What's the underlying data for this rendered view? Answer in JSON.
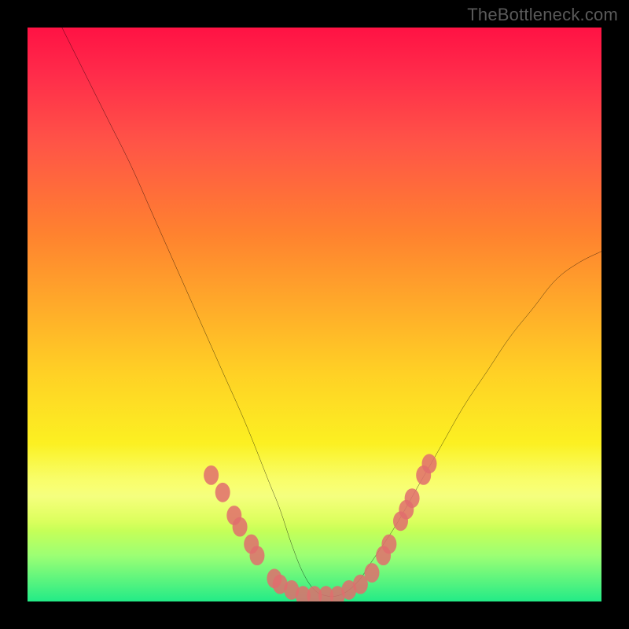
{
  "watermark": "TheBottleneck.com",
  "colors": {
    "frame": "#000000",
    "curve": "#000000",
    "marker": "#e06d6d",
    "gradient_top": "#ff1244",
    "gradient_bottom": "#23eb87"
  },
  "chart_data": {
    "type": "line",
    "title": "",
    "xlabel": "",
    "ylabel": "",
    "xlim": [
      0,
      100
    ],
    "ylim": [
      0,
      100
    ],
    "grid": false,
    "legend": false,
    "series": [
      {
        "name": "bottleneck-curve",
        "x": [
          6,
          10,
          14,
          18,
          22,
          26,
          30,
          34,
          38,
          42,
          44,
          46,
          48,
          50,
          52,
          54,
          56,
          58,
          60,
          64,
          68,
          72,
          76,
          80,
          84,
          88,
          92,
          96,
          100
        ],
        "y": [
          100,
          92,
          84,
          76,
          67,
          58,
          49,
          40,
          31,
          21,
          16,
          10,
          5,
          2,
          1,
          1,
          2,
          4,
          7,
          13,
          20,
          27,
          34,
          40,
          46,
          51,
          56,
          59,
          61
        ]
      }
    ],
    "markers": [
      {
        "x": 32,
        "y": 22
      },
      {
        "x": 34,
        "y": 19
      },
      {
        "x": 36,
        "y": 15
      },
      {
        "x": 37,
        "y": 13
      },
      {
        "x": 39,
        "y": 10
      },
      {
        "x": 40,
        "y": 8
      },
      {
        "x": 43,
        "y": 4
      },
      {
        "x": 44,
        "y": 3
      },
      {
        "x": 46,
        "y": 2
      },
      {
        "x": 48,
        "y": 1
      },
      {
        "x": 50,
        "y": 1
      },
      {
        "x": 52,
        "y": 1
      },
      {
        "x": 54,
        "y": 1
      },
      {
        "x": 56,
        "y": 2
      },
      {
        "x": 58,
        "y": 3
      },
      {
        "x": 60,
        "y": 5
      },
      {
        "x": 62,
        "y": 8
      },
      {
        "x": 63,
        "y": 10
      },
      {
        "x": 65,
        "y": 14
      },
      {
        "x": 66,
        "y": 16
      },
      {
        "x": 67,
        "y": 18
      },
      {
        "x": 69,
        "y": 22
      },
      {
        "x": 70,
        "y": 24
      }
    ]
  }
}
